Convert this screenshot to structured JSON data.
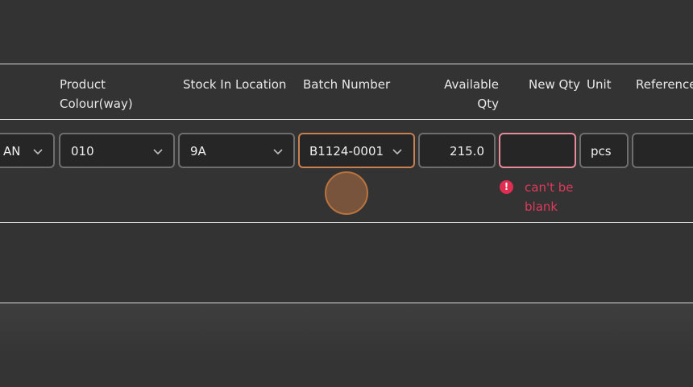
{
  "headers": {
    "product_colour": "Product Colour(way)",
    "stock_location": "Stock In Location",
    "batch_number": "Batch Number",
    "available_qty": "Available Qty",
    "new_qty": "New Qty",
    "unit": "Unit",
    "reference": "Reference"
  },
  "row": {
    "product_value": "AN",
    "colour_value": "010",
    "location_value": "9A",
    "batch_value": "B1124-0001",
    "available_value": "215.0",
    "new_qty_value": "",
    "unit_value": "pcs",
    "reference_value": ""
  },
  "validation": {
    "message": "can't be blank",
    "icon": "exclamation-circle-icon",
    "color": "#e0395c"
  },
  "colors": {
    "background": "#333333",
    "field_background": "#262626",
    "field_border": "#6e6e6e",
    "focus_border": "#c88050",
    "error_border": "#e88a9a"
  }
}
